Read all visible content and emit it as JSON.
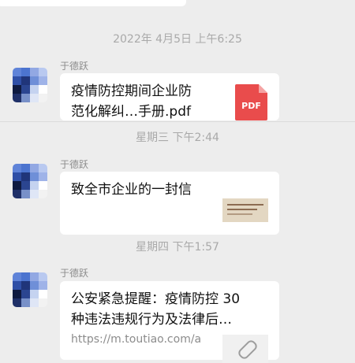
{
  "chat": {
    "timestamps": [
      "2022年 4月5日 上午6:25",
      "星期三 下午2:44",
      "星期四 下午1:57"
    ],
    "messages": [
      {
        "sender": "于德跃",
        "file_title_line1": "疫情防控期间企业防",
        "file_title_line2": "范化解纠…手册.pdf",
        "file_icon": "pdf-icon",
        "file_icon_label": "PDF"
      },
      {
        "sender": "于德跃",
        "card_title": "致全市企业的一封信",
        "thumbnail": "letter-thumbnail"
      },
      {
        "sender": "于德跃",
        "link_title_line1": "公安紧急提醒：疫情防控 30",
        "link_title_line2": "种违法违规行为及法律后…",
        "link_url": "https://m.toutiao.com/a",
        "link_icon": "link-icon"
      }
    ]
  },
  "colors": {
    "background": "#ededed",
    "bubble": "#ffffff",
    "pdf_red": "#e94c4c",
    "timestamp_text": "#a9a9a9"
  }
}
